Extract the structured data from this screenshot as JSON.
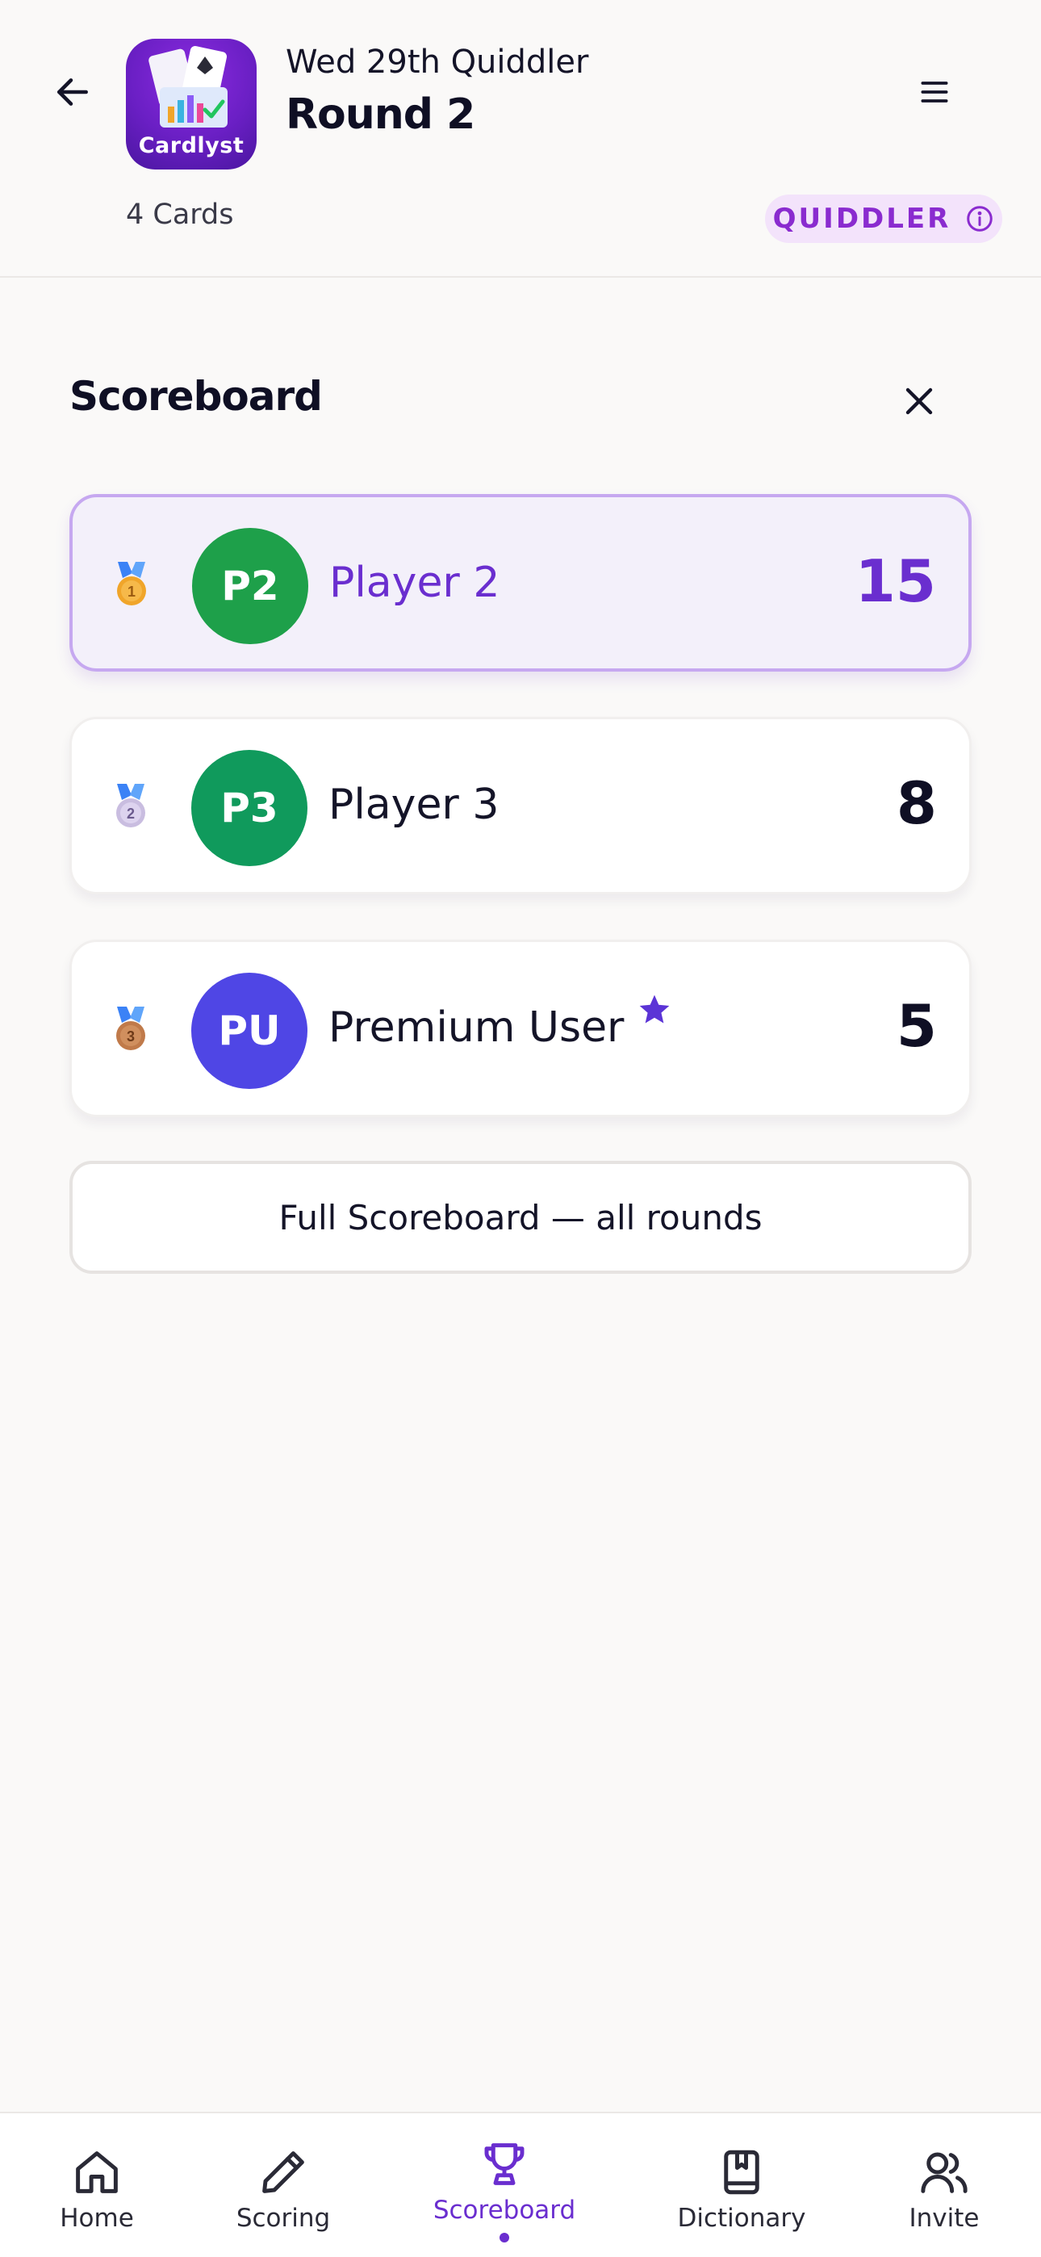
{
  "header": {
    "app_name": "Cardlyst",
    "game_title": "Wed 29th Quiddler",
    "round_title": "Round 2",
    "cards_count": "4 Cards",
    "game_badge": "QUIDDLER"
  },
  "scoreboard": {
    "title": "Scoreboard",
    "players": [
      {
        "rank": "1",
        "initials": "P2",
        "name": "Player 2",
        "score": "15",
        "avatar_color": "#1ea04a",
        "premium": false,
        "leader": true
      },
      {
        "rank": "2",
        "initials": "P3",
        "name": "Player 3",
        "score": "8",
        "avatar_color": "#109a5c",
        "premium": false,
        "leader": false
      },
      {
        "rank": "3",
        "initials": "PU",
        "name": "Premium User",
        "score": "5",
        "avatar_color": "#4f46e5",
        "premium": true,
        "leader": false
      }
    ],
    "full_button_label": "Full Scoreboard — all rounds"
  },
  "nav": {
    "items": [
      {
        "label": "Home",
        "icon": "home-icon",
        "active": false
      },
      {
        "label": "Scoring",
        "icon": "pencil-icon",
        "active": false
      },
      {
        "label": "Scoreboard",
        "icon": "trophy-icon",
        "active": true
      },
      {
        "label": "Dictionary",
        "icon": "book-icon",
        "active": false
      },
      {
        "label": "Invite",
        "icon": "users-icon",
        "active": false
      }
    ]
  },
  "colors": {
    "accent": "#6a2ecf",
    "badge_text": "#8a2bcf",
    "badge_bg": "#f3e3fb",
    "leader_border": "#c6a8f0",
    "medal_gold": "#f0a52a",
    "medal_silver": "#c9bde0",
    "medal_bronze": "#c07a4a"
  }
}
